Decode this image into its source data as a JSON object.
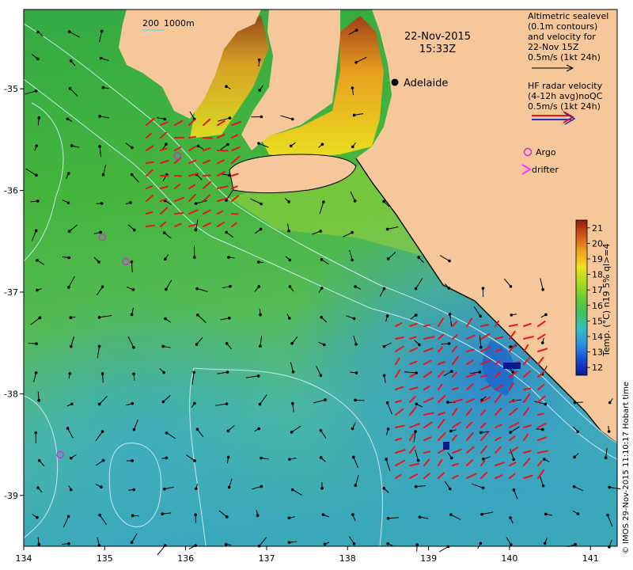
{
  "header": {
    "date": "22-Nov-2015",
    "time": "15:33Z"
  },
  "scale_bar": {
    "label_a": "200",
    "label_b": "1000m"
  },
  "places": [
    {
      "name": "Adelaide",
      "lon": 138.6,
      "lat": -34.93
    }
  ],
  "legend": {
    "altimetry": {
      "line1": "Altimetric sealevel",
      "line2": "(0.1m contours)",
      "line3": "and velocity for",
      "line4": "22-Nov 15Z",
      "line5": "0.5m/s (1kt 24h)"
    },
    "hf_radar": {
      "line1": "HF radar velocity",
      "line2": "(4-12h avg)noQC",
      "line3": "0.5m/s (1kt 24h)"
    },
    "argo": "Argo",
    "drifter": "drifter",
    "colors": {
      "argo": "#cc33cc",
      "drifter": "#ff33ff",
      "hf_radar_arrow": "#e8141e",
      "altimetry_arrow": "#000000"
    }
  },
  "axes": {
    "x_ticks": [
      "134",
      "135",
      "136",
      "137",
      "138",
      "139",
      "140",
      "141"
    ],
    "y_ticks": [
      "-35",
      "-36",
      "-37",
      "-38",
      "-39"
    ],
    "xlim": [
      134,
      141.3
    ],
    "ylim": [
      -39.5,
      -34.2
    ]
  },
  "colorbar": {
    "label": "Temp. (°C) n19 5% ql>=4",
    "ticks": [
      "12",
      "13",
      "14",
      "15",
      "16",
      "17",
      "18",
      "19",
      "20",
      "21"
    ],
    "range": [
      11.5,
      21.5
    ]
  },
  "argo_floats": [
    {
      "lon": 135.9,
      "lat": -35.66
    },
    {
      "lon": 134.97,
      "lat": -36.46
    },
    {
      "lon": 135.26,
      "lat": -36.7
    },
    {
      "lon": 134.45,
      "lat": -38.6
    }
  ],
  "credit": "© IMOS 29-Nov-2015 11:10:17 Hobart time"
}
